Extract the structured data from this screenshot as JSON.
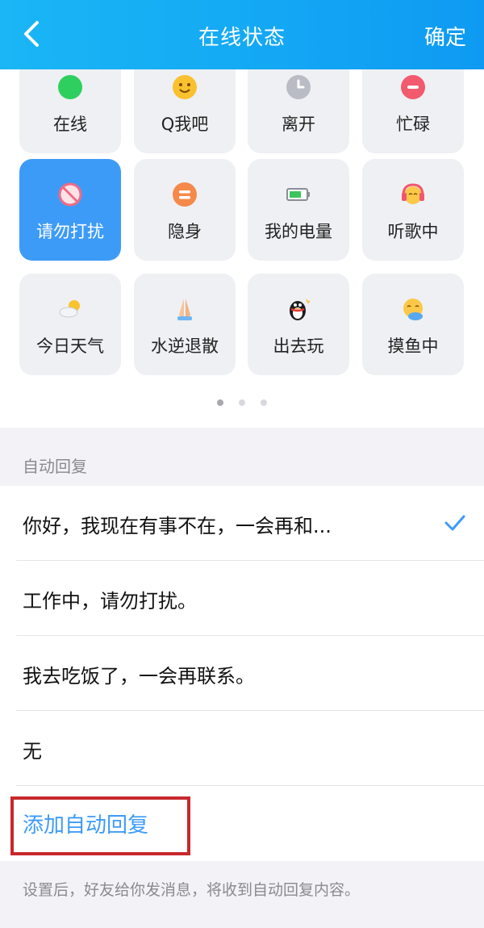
{
  "header": {
    "title": "在线状态",
    "confirm_label": "确定",
    "back_icon": "chevron-left-icon"
  },
  "statuses": [
    {
      "label": "在线",
      "icon": "green-dot-icon",
      "selected": false
    },
    {
      "label": "Q我吧",
      "icon": "smiley-icon",
      "selected": false
    },
    {
      "label": "离开",
      "icon": "clock-icon",
      "selected": false
    },
    {
      "label": "忙碌",
      "icon": "busy-icon",
      "selected": false
    },
    {
      "label": "请勿打扰",
      "icon": "no-entry-icon",
      "selected": true
    },
    {
      "label": "隐身",
      "icon": "invisible-icon",
      "selected": false
    },
    {
      "label": "我的电量",
      "icon": "battery-icon",
      "selected": false
    },
    {
      "label": "听歌中",
      "icon": "headphones-icon",
      "selected": false
    },
    {
      "label": "今日天气",
      "icon": "weather-icon",
      "selected": false
    },
    {
      "label": "水逆退散",
      "icon": "praying-hands-icon",
      "selected": false
    },
    {
      "label": "出去玩",
      "icon": "penguin-icon",
      "selected": false
    },
    {
      "label": "摸鱼中",
      "icon": "fishing-face-icon",
      "selected": false
    }
  ],
  "pager": {
    "pages": 3,
    "active_page": 1
  },
  "auto_reply": {
    "section_label": "自动回复",
    "items": [
      {
        "text": "你好，我现在有事不在，一会再和...",
        "checked": true
      },
      {
        "text": "工作中，请勿打扰。",
        "checked": false
      },
      {
        "text": "我去吃饭了，一会再联系。",
        "checked": false
      },
      {
        "text": "无",
        "checked": false
      }
    ],
    "add_label": "添加自动回复",
    "footer_note": "设置后，好友给你发消息，将收到自动回复内容。"
  },
  "colors": {
    "header_bg": "#14a8f4",
    "accent_blue": "#3d9bf8",
    "highlight_red": "#c7282c",
    "card_bg": "#eef0f3"
  }
}
